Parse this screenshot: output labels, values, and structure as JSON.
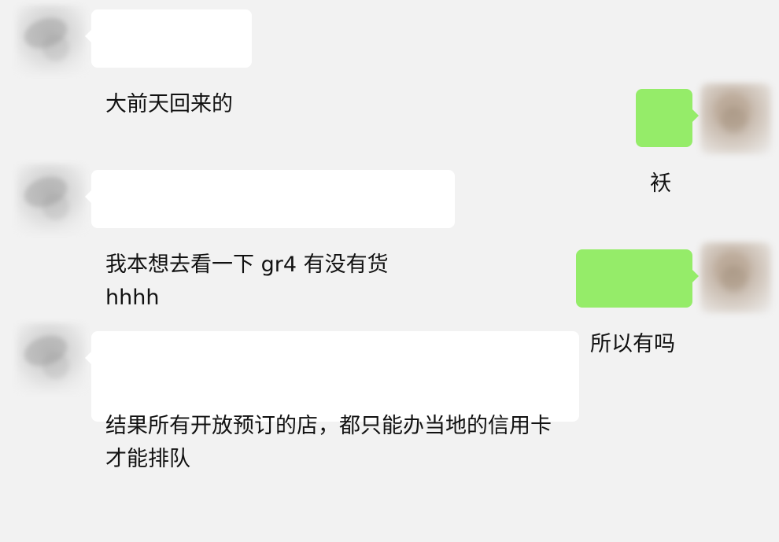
{
  "messages": [
    {
      "side": "left",
      "text": "大前天回来的"
    },
    {
      "side": "right",
      "text": "袄"
    },
    {
      "side": "left",
      "text": "我本想去看一下 gr4 有没有货 hhhh"
    },
    {
      "side": "right",
      "text": "所以有吗"
    },
    {
      "side": "left",
      "text": "结果所有开放预订的店，都只能办当地的信用卡\n才能排队"
    }
  ],
  "colors": {
    "background": "#f2f2f2",
    "incoming_bubble": "#ffffff",
    "outgoing_bubble": "#95ec69",
    "text": "#111111"
  },
  "icons": {
    "incoming_avatar": "blurred-avatar",
    "outgoing_avatar": "blurred-avatar"
  }
}
